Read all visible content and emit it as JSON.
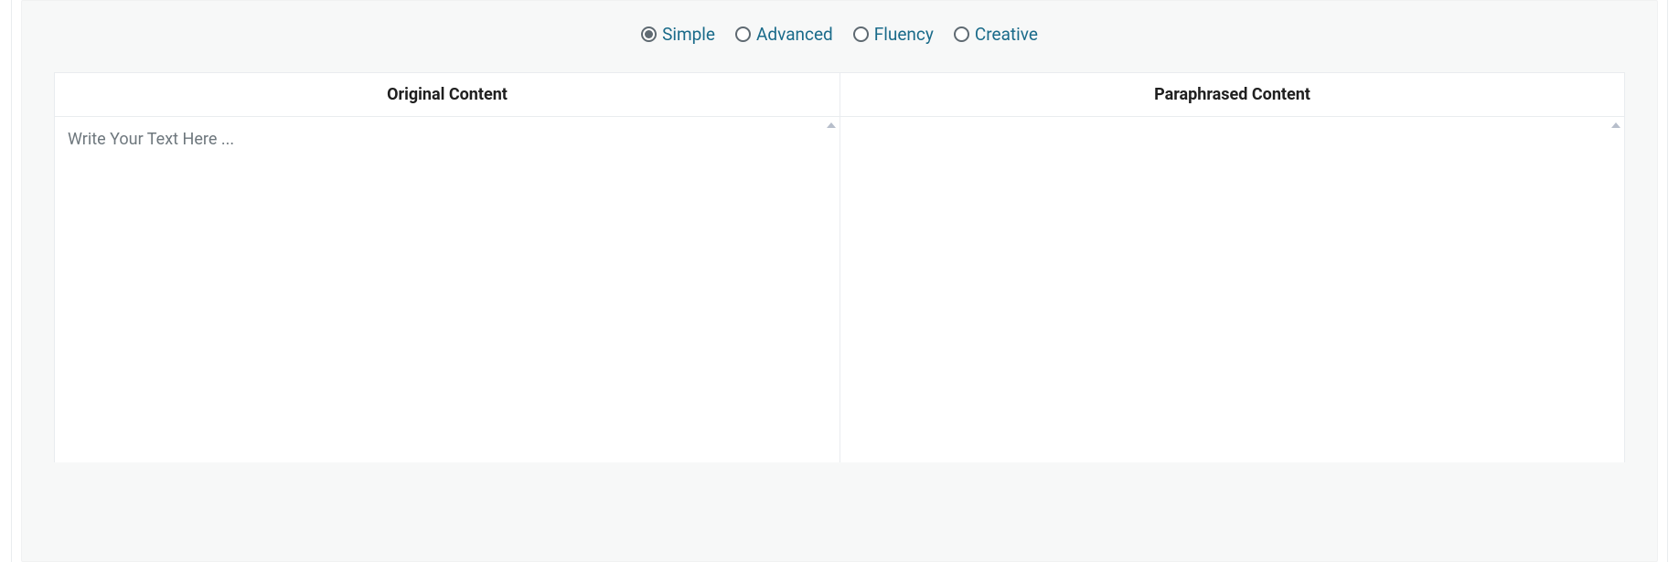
{
  "modes": {
    "options": [
      {
        "key": "simple",
        "label": "Simple",
        "selected": true
      },
      {
        "key": "advanced",
        "label": "Advanced",
        "selected": false
      },
      {
        "key": "fluency",
        "label": "Fluency",
        "selected": false
      },
      {
        "key": "creative",
        "label": "Creative",
        "selected": false
      }
    ]
  },
  "columns": {
    "original": {
      "header": "Original Content",
      "placeholder": "Write Your Text Here ...",
      "value": ""
    },
    "paraphrased": {
      "header": "Paraphrased Content",
      "value": ""
    }
  }
}
